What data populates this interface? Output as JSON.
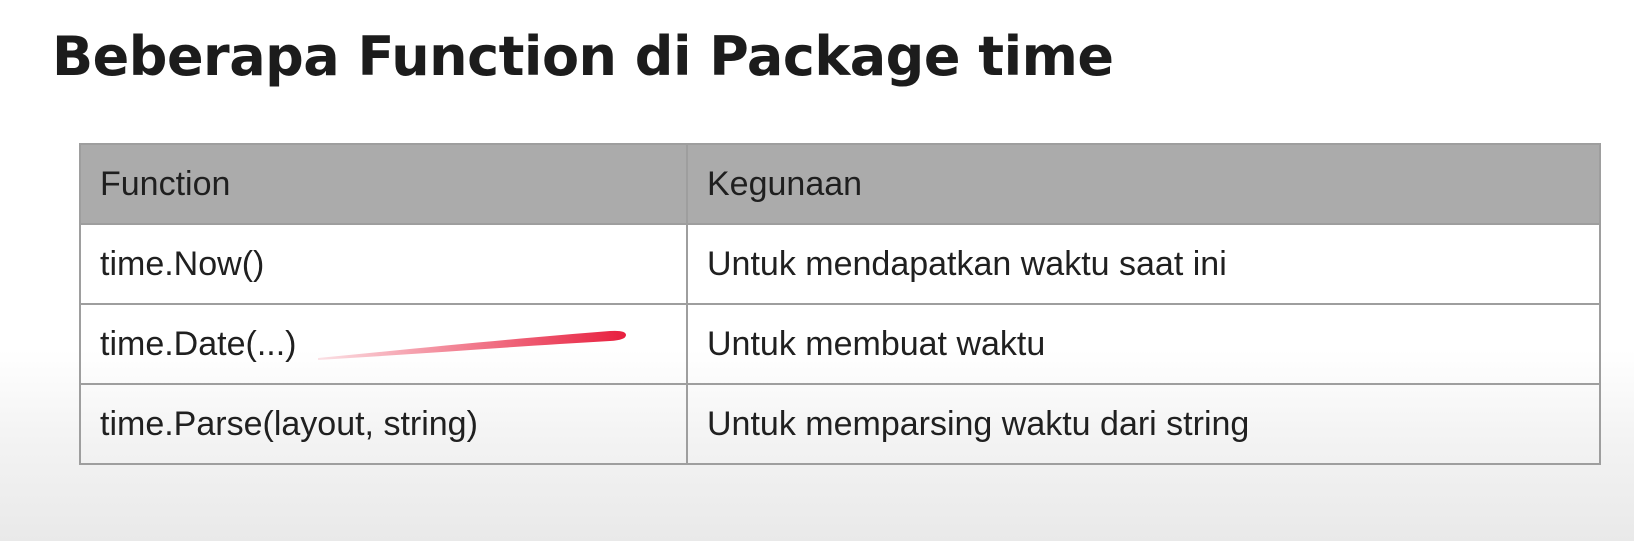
{
  "slide": {
    "title": "Beberapa Function di Package time"
  },
  "table": {
    "headers": [
      "Function",
      "Kegunaan"
    ],
    "rows": [
      {
        "function": "time.Now()",
        "usage": "Untuk mendapatkan waktu saat ini"
      },
      {
        "function": "time.Date(...)",
        "usage": "Untuk membuat waktu"
      },
      {
        "function": "time.Parse(layout, string)",
        "usage": "Untuk memparsing waktu dari string"
      }
    ]
  },
  "annotation": {
    "color": "#e8203f"
  }
}
